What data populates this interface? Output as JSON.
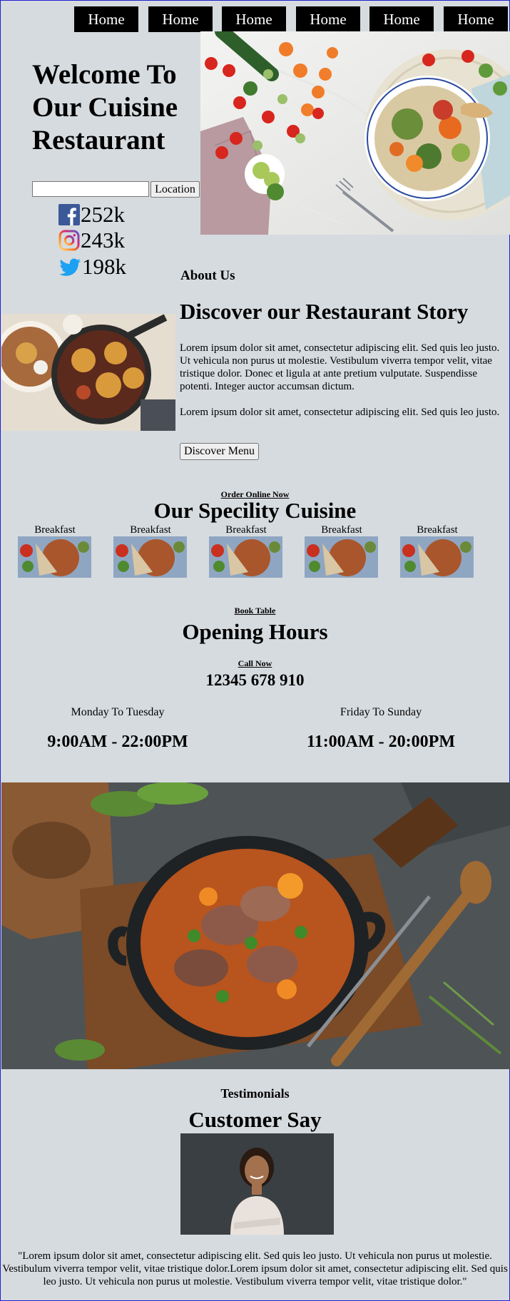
{
  "nav": {
    "items": [
      "Home",
      "Home",
      "Home",
      "Home",
      "Home",
      "Home"
    ]
  },
  "hero": {
    "title": "Welcome To Our Cuisine Restaurant",
    "search": {
      "value": "",
      "placeholder": ""
    },
    "location_button": "Location",
    "social": [
      {
        "icon": "facebook-icon",
        "count": "252k",
        "color": "#3b5998"
      },
      {
        "icon": "instagram-icon",
        "count": "243k",
        "color": "#d62976"
      },
      {
        "icon": "twitter-icon",
        "count": "198k",
        "color": "#1da1f2"
      }
    ]
  },
  "about": {
    "kicker": "About Us",
    "title": "Discover our Restaurant Story",
    "p1": "Lorem ipsum dolor sit amet, consectetur adipiscing elit. Sed quis leo justo. Ut vehicula non purus ut molestie. Vestibulum viverra tempor velit, vitae tristique dolor. Donec et ligula at ante pretium vulputate. Suspendisse potenti. Integer auctor accumsan dictum.",
    "p2": "Lorem ipsum dolor sit amet, consectetur adipiscing elit. Sed quis leo justo.",
    "button": "Discover Menu"
  },
  "specialty": {
    "link": "Order Online Now",
    "title": "Our Specility Cuisine",
    "items": [
      "Breakfast",
      "Breakfast",
      "Breakfast",
      "Breakfast",
      "Breakfast"
    ]
  },
  "hours": {
    "link": "Book Table",
    "title": "Opening Hours",
    "call_link": "Call Now",
    "phone": "12345 678 910",
    "schedule": [
      {
        "days": "Monday To Tuesday",
        "time": "9:00AM - 22:00PM"
      },
      {
        "days": "Friday To Sunday",
        "time": "11:00AM - 20:00PM"
      }
    ]
  },
  "testimonials": {
    "kicker": "Testimonials",
    "title": "Customer Say",
    "quote": "\"Lorem ipsum dolor sit amet, consectetur adipiscing elit. Sed quis leo justo. Ut vehicula non purus ut molestie. Vestibulum viverra tempor velit, vitae tristique dolor.Lorem ipsum dolor sit amet, consectetur adipiscing elit. Sed quis leo justo. Ut vehicula non purus ut molestie. Vestibulum viverra tempor velit, vitae tristique dolor.\""
  },
  "colors": {
    "background": "#d6dbdf",
    "nav_bg": "#000000",
    "nav_text": "#ffffff",
    "border": "#1f1fcf"
  }
}
